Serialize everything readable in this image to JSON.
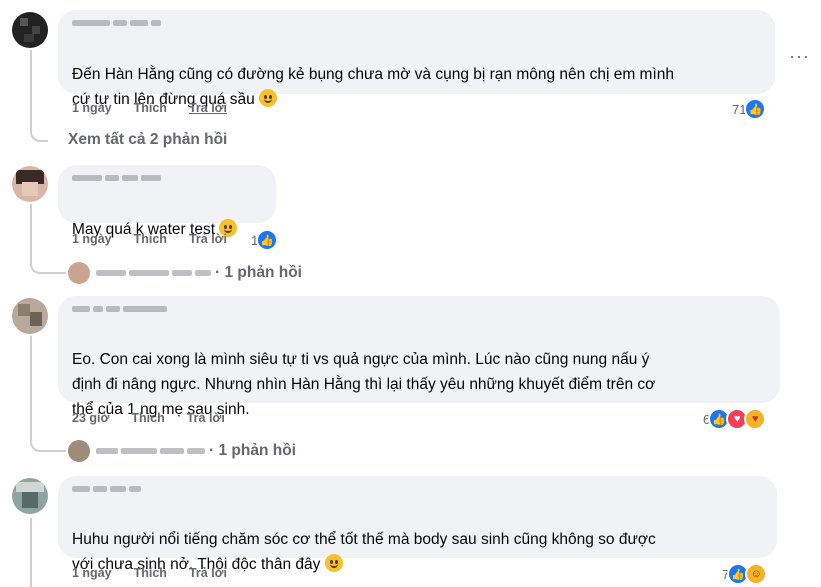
{
  "comments": [
    {
      "text": "Đến Hàn Hằng cũng có đường kẻ bụng chưa mờ và cụng bị rạn mông nên chị em mình\ncứ tự tin lên đừng quá sầu",
      "time": "1 ngày",
      "like": "Thích",
      "reply": "Trả lời",
      "reaction_count": "71",
      "reactions": [
        "like-icon"
      ],
      "emoji": "smiling-emoji"
    },
    {
      "text": "May quá k water test",
      "time": "1 ngày",
      "like": "Thích",
      "reply": "Trả lời",
      "reaction_count": "1",
      "reactions": [
        "like-icon"
      ],
      "emoji": "laughing-emoji"
    },
    {
      "text": "Eo. Con cai     xong là mình siêu tự ti vs quả ngực của mình. Lúc nào cũng nung nấu ý\nđịnh đi nâng ngực. Nhưng nhìn Hàn Hằng thì lại thấy yêu những khuyết điểm trên cơ\nthể của 1 ng mẹ sau sinh.",
      "time": "23 giờ",
      "like": "Thích",
      "reply": "Trả lời",
      "reaction_count": "6",
      "reactions": [
        "like-icon",
        "love-icon",
        "care-icon"
      ]
    },
    {
      "text": "Huhu người nổi tiếng chăm sóc cơ thể tốt thế mà body sau sinh cũng không so được\nvới chưa sinh nở. Thôi độc thân đây",
      "time": "1 ngày",
      "like": "Thích",
      "reply": "Trả lời",
      "reaction_count": "7",
      "reactions": [
        "like-icon",
        "haha-icon"
      ],
      "emoji": "grinning-emoji"
    }
  ],
  "view_all_replies": "Xem tất cả 2 phản hồi",
  "reply_summary_2": "· 1 phản hồi",
  "reply_summary_3": "· 1 phản hồi",
  "more_options": "···",
  "colors": {
    "bubble": "#f0f2f5",
    "meta": "#65676b",
    "like_blue": "#1877f2"
  }
}
